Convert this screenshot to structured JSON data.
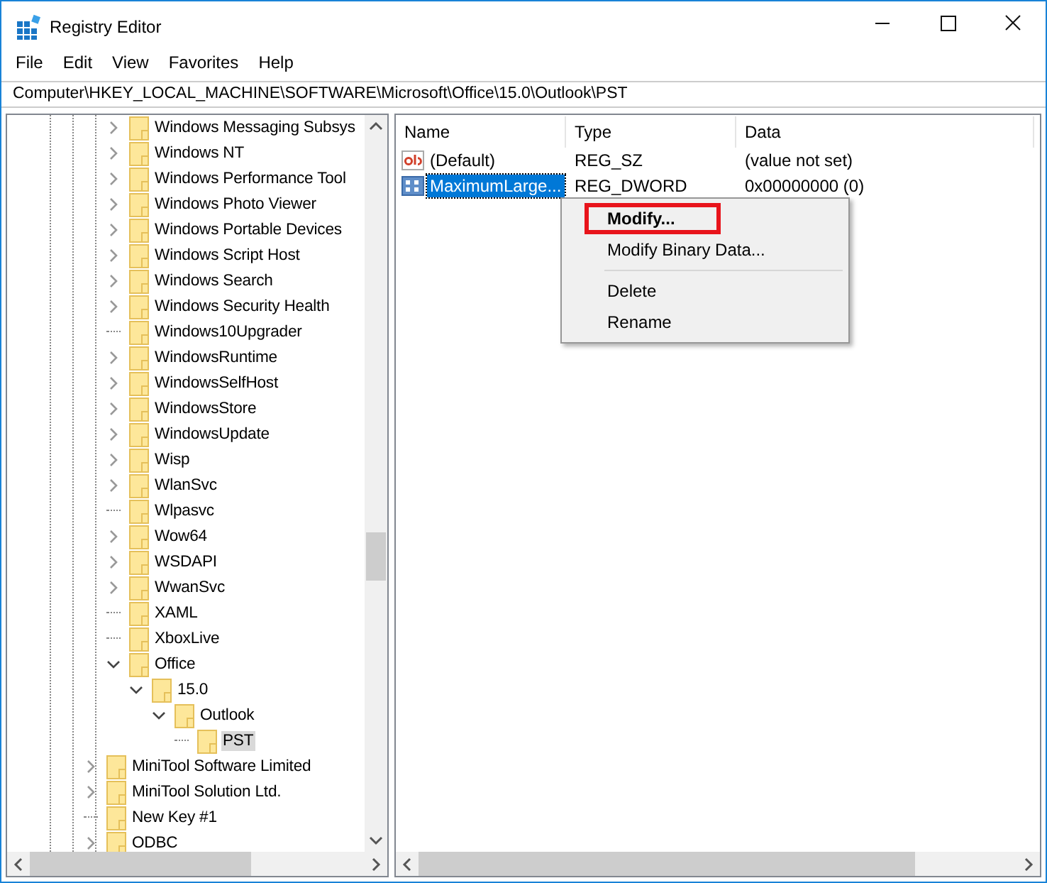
{
  "window": {
    "title": "Registry Editor"
  },
  "menu": [
    "File",
    "Edit",
    "View",
    "Favorites",
    "Help"
  ],
  "address": "Computer\\HKEY_LOCAL_MACHINE\\SOFTWARE\\Microsoft\\Office\\15.0\\Outlook\\PST",
  "tree": {
    "items": [
      {
        "children": [
          {
            "label": "Windows Messaging Subsys",
            "has_children": true,
            "expanded": false,
            "selected": false
          },
          {
            "label": "Windows NT",
            "has_children": true,
            "expanded": false,
            "selected": false
          },
          {
            "label": "Windows Performance Tool",
            "has_children": true,
            "expanded": false,
            "selected": false
          },
          {
            "label": "Windows Photo Viewer",
            "has_children": true,
            "expanded": false,
            "selected": false
          },
          {
            "label": "Windows Portable Devices",
            "has_children": true,
            "expanded": false,
            "selected": false
          },
          {
            "label": "Windows Script Host",
            "has_children": true,
            "expanded": false,
            "selected": false
          },
          {
            "label": "Windows Search",
            "has_children": true,
            "expanded": false,
            "selected": false
          },
          {
            "label": "Windows Security Health",
            "has_children": true,
            "expanded": false,
            "selected": false
          },
          {
            "label": "Windows10Upgrader",
            "has_children": false,
            "selected": false
          },
          {
            "label": "WindowsRuntime",
            "has_children": true,
            "expanded": false,
            "selected": false
          },
          {
            "label": "WindowsSelfHost",
            "has_children": true,
            "expanded": false,
            "selected": false
          },
          {
            "label": "WindowsStore",
            "has_children": true,
            "expanded": false,
            "selected": false
          },
          {
            "label": "WindowsUpdate",
            "has_children": true,
            "expanded": false,
            "selected": false
          },
          {
            "label": "Wisp",
            "has_children": true,
            "expanded": false,
            "selected": false
          },
          {
            "label": "WlanSvc",
            "has_children": true,
            "expanded": false,
            "selected": false
          },
          {
            "label": "Wlpasvc",
            "has_children": false,
            "selected": false
          },
          {
            "label": "Wow64",
            "has_children": true,
            "expanded": false,
            "selected": false
          },
          {
            "label": "WSDAPI",
            "has_children": true,
            "expanded": false,
            "selected": false
          },
          {
            "label": "WwanSvc",
            "has_children": true,
            "expanded": false,
            "selected": false
          },
          {
            "label": "XAML",
            "has_children": false,
            "selected": false
          },
          {
            "label": "XboxLive",
            "has_children": false,
            "selected": false
          },
          {
            "label": "Office",
            "has_children": true,
            "expanded": true,
            "selected": false,
            "children": [
              {
                "label": "15.0",
                "has_children": true,
                "expanded": true,
                "selected": false,
                "children": [
                  {
                    "label": "Outlook",
                    "has_children": true,
                    "expanded": true,
                    "selected": false,
                    "children": [
                      {
                        "label": "PST",
                        "has_children": false,
                        "selected": true
                      }
                    ]
                  }
                ]
              }
            ]
          }
        ]
      },
      {
        "label": "MiniTool Software Limited",
        "has_children": true,
        "expanded": false,
        "selected": false
      },
      {
        "label": "MiniTool Solution Ltd.",
        "has_children": true,
        "expanded": false,
        "selected": false
      },
      {
        "label": "New Key #1",
        "has_children": false,
        "selected": false
      },
      {
        "label": "ODBC",
        "has_children": true,
        "expanded": false,
        "selected": false
      }
    ]
  },
  "values": {
    "columns": [
      "Name",
      "Type",
      "Data"
    ],
    "rows": [
      {
        "kind": "string",
        "name": "(Default)",
        "type": "REG_SZ",
        "data": "(value not set)",
        "selected": false
      },
      {
        "kind": "binary",
        "name": "MaximumLarge...",
        "type": "REG_DWORD",
        "data": "0x00000000 (0)",
        "selected": true
      }
    ]
  },
  "context_menu": [
    {
      "kind": "item",
      "label": "Modify...",
      "default": true,
      "highlighted": true
    },
    {
      "kind": "item",
      "label": "Modify Binary Data...",
      "default": false,
      "highlighted": false
    },
    {
      "kind": "separator"
    },
    {
      "kind": "item",
      "label": "Delete",
      "default": false,
      "highlighted": false
    },
    {
      "kind": "item",
      "label": "Rename",
      "default": false,
      "highlighted": false
    }
  ]
}
